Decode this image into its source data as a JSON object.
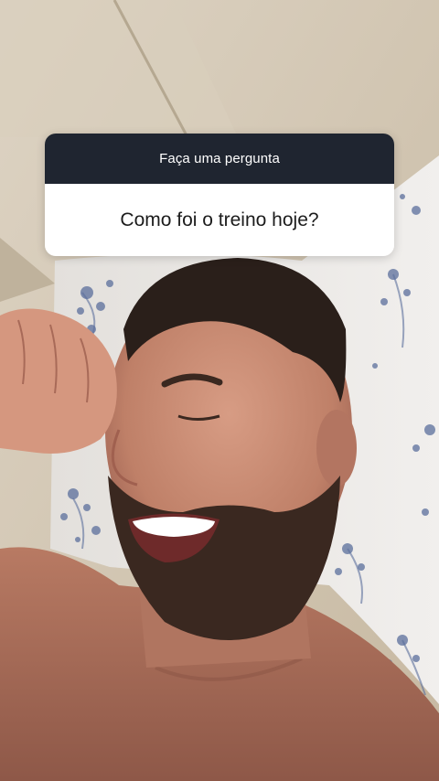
{
  "story": {
    "background": {
      "photo_description": "",
      "colors": {
        "wall": "#d8cdbb",
        "wall_shadow": "#b7aa93",
        "pillow": "#eceae8",
        "pillow_pattern": "#5b6f9c",
        "skin": "#c98e76",
        "skin_shadow": "#9c6152",
        "hair": "#2a1f1a",
        "beard": "#3a2820"
      }
    },
    "question_sticker": {
      "header_label": "Faça uma pergunta",
      "question_text": "Como foi o treino hoje?",
      "header_color": "#1f2530",
      "body_color": "#ffffff"
    }
  }
}
